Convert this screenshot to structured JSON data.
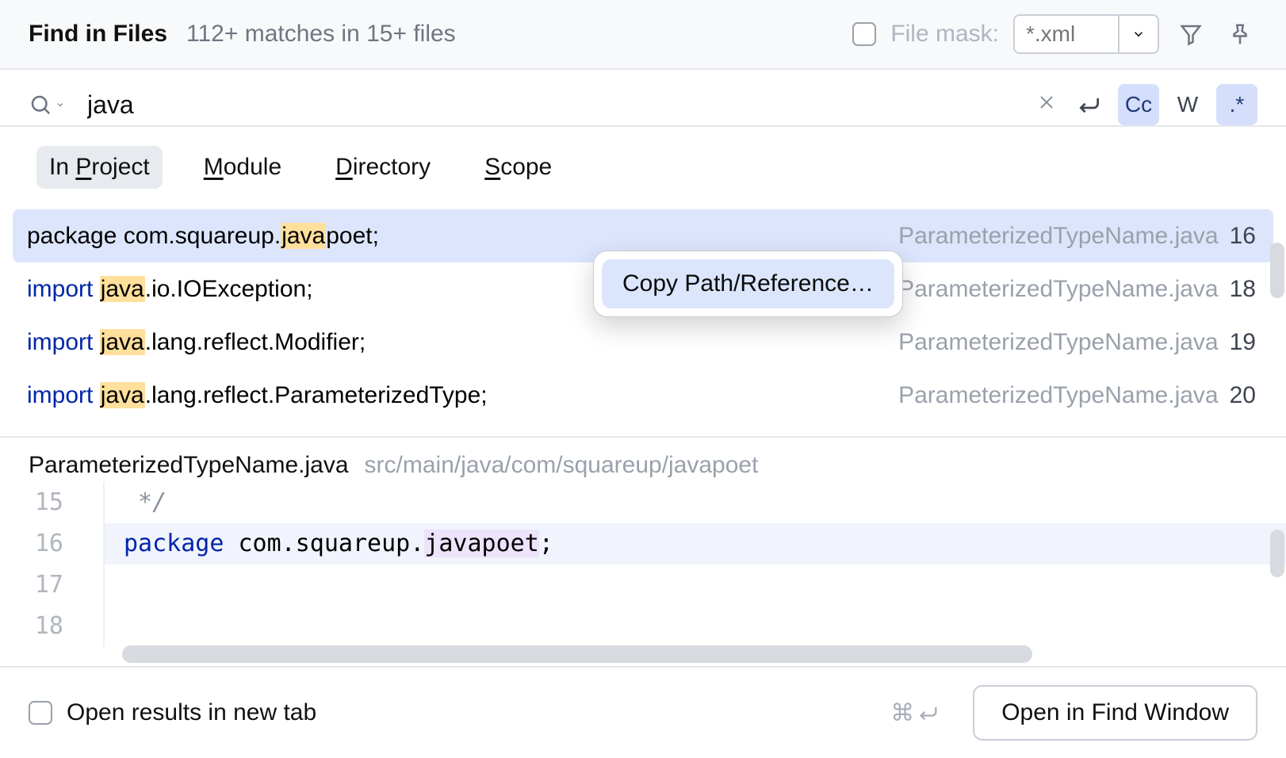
{
  "header": {
    "title": "Find in Files",
    "subtitle": "112+ matches in 15+ files",
    "file_mask_label": "File mask:",
    "file_mask_placeholder": "*.xml"
  },
  "search": {
    "query": "java",
    "options": {
      "cc": "Cc",
      "word": "W",
      "regex": ".*"
    }
  },
  "tabs": {
    "project_prefix": "In ",
    "project_u": "P",
    "project_rest": "roject",
    "module_u": "M",
    "module_rest": "odule",
    "directory_u": "D",
    "directory_rest": "irectory",
    "scope_u": "S",
    "scope_rest": "cope"
  },
  "results": [
    {
      "pre": "package com.squareup.",
      "hl": "java",
      "post": "poet;",
      "file": "ParameterizedTypeName.java",
      "line": "16",
      "selected": true
    },
    {
      "kw": "import",
      "sp": " ",
      "hl": "java",
      "post": ".io.IOException;",
      "file": "ParameterizedTypeName.java",
      "line": "18"
    },
    {
      "kw": "import",
      "sp": " ",
      "hl": "java",
      "post": ".lang.reflect.Modifier;",
      "file": "ParameterizedTypeName.java",
      "line": "19"
    },
    {
      "kw": "import",
      "sp": " ",
      "hl": "java",
      "post": ".lang.reflect.ParameterizedType;",
      "file": "ParameterizedTypeName.java",
      "line": "20"
    }
  ],
  "context_menu": {
    "item": "Copy Path/Reference…"
  },
  "preview": {
    "file": "ParameterizedTypeName.java",
    "path": "src/main/java/com/squareup/javapoet",
    "gutter": [
      "15",
      "16",
      "17",
      "18"
    ],
    "line15": " */",
    "line16_kw": "package",
    "line16_mid": " com.squareup.",
    "line16_usage": "javapoet",
    "line16_end": ";",
    "line17": "",
    "line18": ""
  },
  "footer": {
    "open_new_tab": "Open results in new tab",
    "shortcut": "⌘⏎",
    "open_btn": "Open in Find Window"
  }
}
